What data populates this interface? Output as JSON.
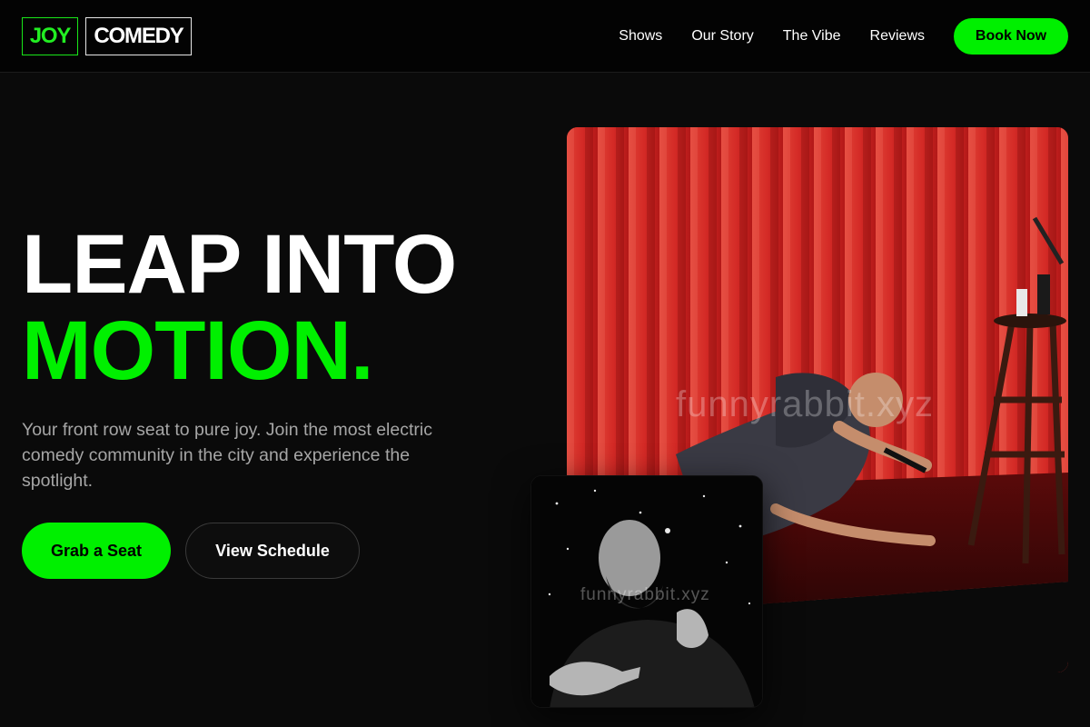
{
  "brand": {
    "part1": "JOY",
    "part2": "COMEDY"
  },
  "nav": {
    "items": [
      "Shows",
      "Our Story",
      "The Vibe",
      "Reviews"
    ],
    "cta": "Book Now"
  },
  "hero": {
    "title_line1": "LEAP INTO",
    "title_line2": "MOTION.",
    "subtitle": "Your front row seat to pure joy. Join the most electric comedy community in the city and experience the spotlight.",
    "primary_button": "Grab a Seat",
    "secondary_button": "View Schedule"
  },
  "images": {
    "main_watermark": "funnyrabbit.xyz",
    "inset_watermark": "funnyrabbit.xyz"
  },
  "colors": {
    "accent": "#00f000",
    "background": "#0a0a0a",
    "header": "#030303",
    "curtain": "#d42a26"
  }
}
